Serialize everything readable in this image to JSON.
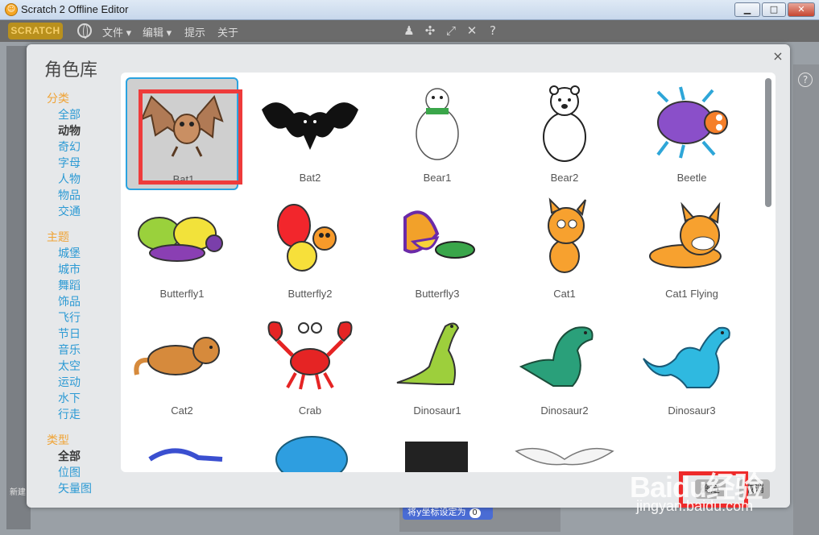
{
  "window": {
    "title": "Scratch 2 Offline Editor",
    "min_label": "▁",
    "max_label": "□",
    "close_label": "✕"
  },
  "menubar": {
    "logo": "SCRATCH",
    "items": [
      "文件 ▾",
      "编辑 ▾",
      "提示",
      "关于"
    ],
    "tools": [
      "stamp-icon",
      "cut-icon",
      "grow-icon",
      "shrink-icon",
      "help-icon"
    ]
  },
  "dialog": {
    "title": "角色库",
    "close": "×",
    "ok_label": "确定",
    "cancel_label": "取消"
  },
  "sidebar": {
    "category_heading": "分类",
    "categories": [
      "全部",
      "动物",
      "奇幻",
      "字母",
      "人物",
      "物品",
      "交通"
    ],
    "active_category": "动物",
    "theme_heading": "主题",
    "themes": [
      "城堡",
      "城市",
      "舞蹈",
      "饰品",
      "飞行",
      "节日",
      "音乐",
      "太空",
      "运动",
      "水下",
      "行走"
    ],
    "type_heading": "类型",
    "types": [
      "全部",
      "位图",
      "矢量图"
    ],
    "active_type": "全部"
  },
  "sprites": [
    {
      "name": "Bat1",
      "selected": true
    },
    {
      "name": "Bat2"
    },
    {
      "name": "Bear1"
    },
    {
      "name": "Bear2"
    },
    {
      "name": "Beetle"
    },
    {
      "name": "Butterfly1"
    },
    {
      "name": "Butterfly2"
    },
    {
      "name": "Butterfly3"
    },
    {
      "name": "Cat1"
    },
    {
      "name": "Cat1 Flying"
    },
    {
      "name": "Cat2"
    },
    {
      "name": "Crab"
    },
    {
      "name": "Dinosaur1"
    },
    {
      "name": "Dinosaur2"
    },
    {
      "name": "Dinosaur3"
    }
  ],
  "background": {
    "block_text": "将y坐标设定为",
    "block_value": "0",
    "new_label": "新建",
    "help": "?"
  },
  "watermark": {
    "logo": "Baidu经验",
    "url": "jingyan.baidu.com"
  },
  "colors": {
    "accent": "#2aa3e0",
    "heading": "#f0a335",
    "link": "#2c9ad4",
    "highlight": "#ee3b3b"
  }
}
